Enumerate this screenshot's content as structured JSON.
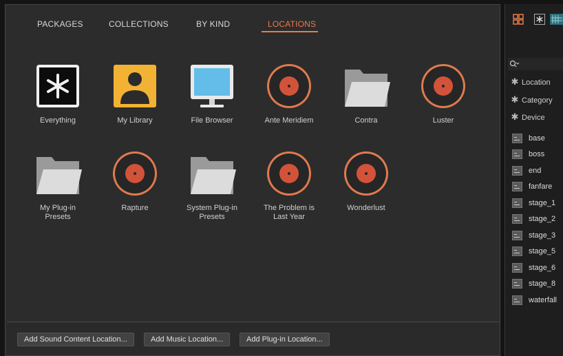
{
  "tabs": [
    "PACKAGES",
    "COLLECTIONS",
    "BY KIND",
    "LOCATIONS"
  ],
  "active_tab": "LOCATIONS",
  "locations": [
    {
      "label": "Everything",
      "icon": "asterisk-icon"
    },
    {
      "label": "My Library",
      "icon": "user-icon"
    },
    {
      "label": "File Browser",
      "icon": "monitor-icon"
    },
    {
      "label": "Ante Meridiem",
      "icon": "disc-icon"
    },
    {
      "label": "Contra",
      "icon": "folder-icon"
    },
    {
      "label": "Luster",
      "icon": "disc-icon"
    },
    {
      "label": "My Plug-in\nPresets",
      "icon": "folder-icon"
    },
    {
      "label": "Rapture",
      "icon": "disc-icon"
    },
    {
      "label": "System Plug-in\nPresets",
      "icon": "folder-icon"
    },
    {
      "label": "The Problem is\nLast Year",
      "icon": "disc-icon"
    },
    {
      "label": "Wonderlust",
      "icon": "disc-icon"
    }
  ],
  "buttons": [
    "Add Sound Content Location...",
    "Add Music Location...",
    "Add Plug-in Location..."
  ],
  "filters": [
    "Location",
    "Category",
    "Device"
  ],
  "files": [
    "base",
    "boss",
    "end",
    "fanfare",
    "stage_1",
    "stage_2",
    "stage_3",
    "stage_5",
    "stage_6",
    "stage_8",
    "waterfall"
  ],
  "colors": {
    "accent": "#ec7b49",
    "disc_red": "#d2533a",
    "library_yellow": "#f2b233",
    "screen_blue": "#63bde8"
  }
}
